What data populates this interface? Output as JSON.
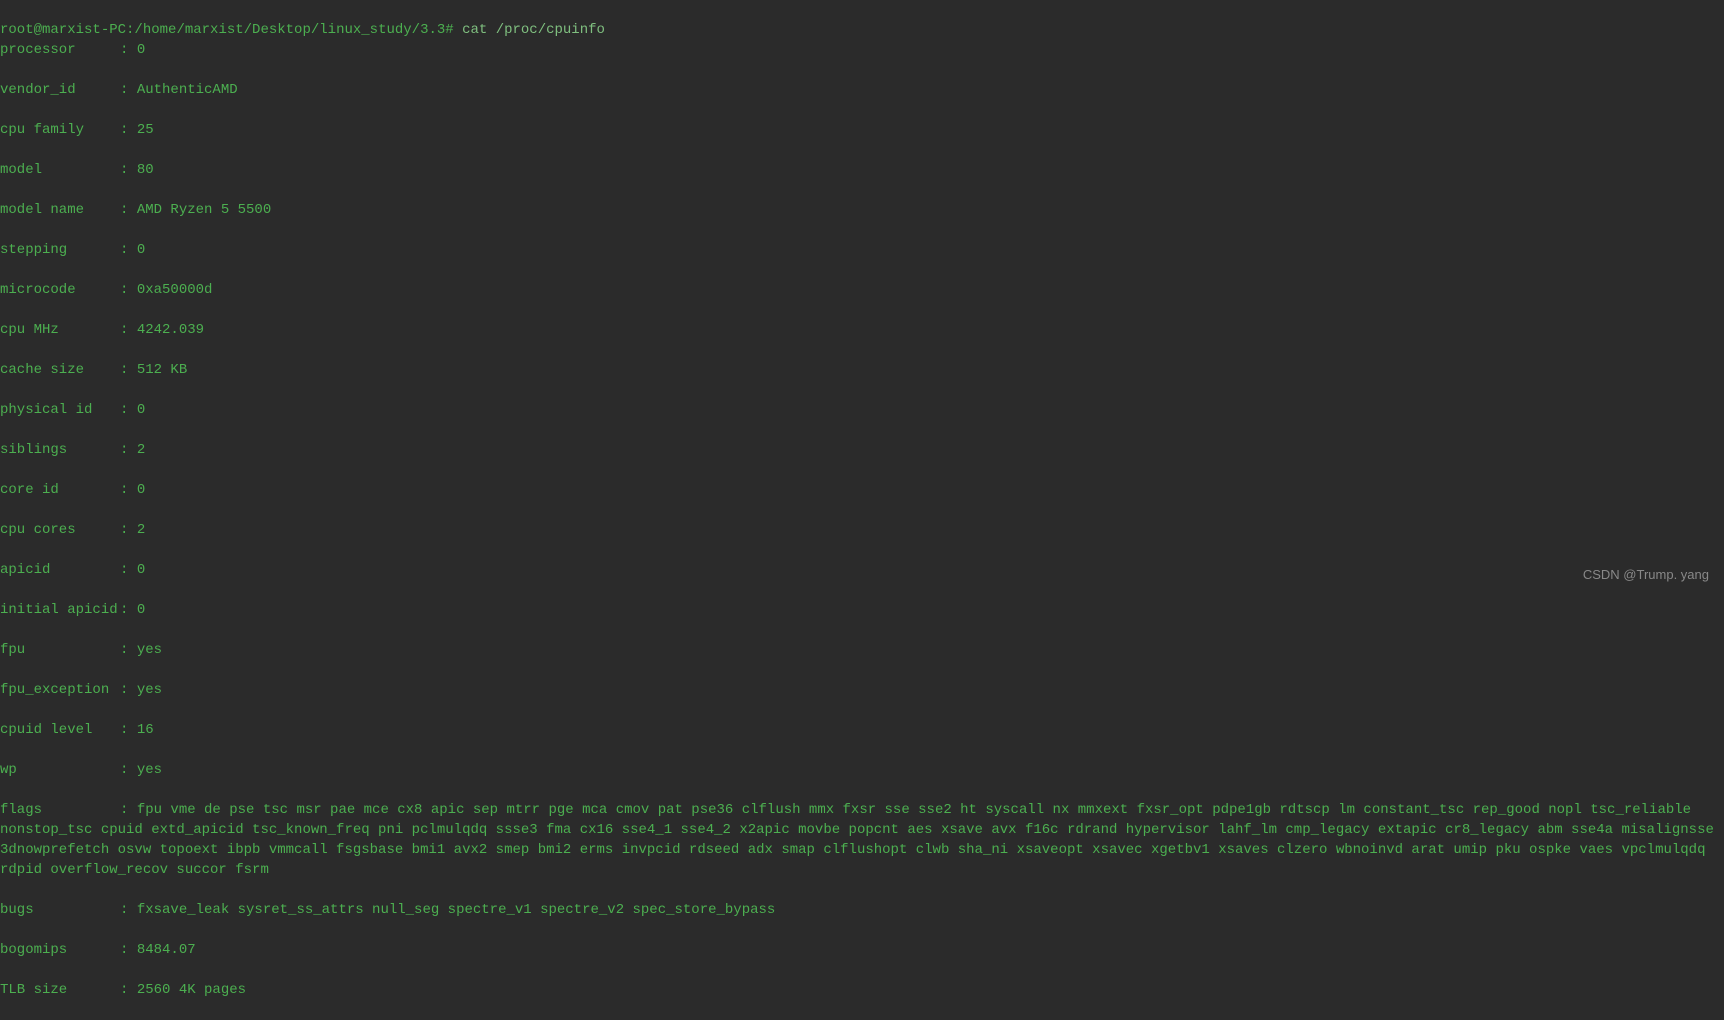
{
  "prompt": {
    "user_host": "root@marxist-PC",
    "path": ":/home/marxist/Desktop/linux_study/3.3#",
    "command": "cat /proc/cpuinfo"
  },
  "cpuinfo": {
    "processor": {
      "key": "processor",
      "val": "0"
    },
    "vendor_id": {
      "key": "vendor_id",
      "val": "AuthenticAMD"
    },
    "cpu_family": {
      "key": "cpu family",
      "val": "25"
    },
    "model": {
      "key": "model",
      "val": "80"
    },
    "model_name": {
      "key": "model name",
      "val": "AMD Ryzen 5 5500"
    },
    "stepping": {
      "key": "stepping",
      "val": "0"
    },
    "microcode": {
      "key": "microcode",
      "val": "0xa50000d"
    },
    "cpu_mhz": {
      "key": "cpu MHz",
      "val": "4242.039"
    },
    "cache_size": {
      "key": "cache size",
      "val": "512 KB"
    },
    "physical_id": {
      "key": "physical id",
      "val": "0"
    },
    "siblings": {
      "key": "siblings",
      "val": "2"
    },
    "core_id": {
      "key": "core id",
      "val": "0"
    },
    "cpu_cores": {
      "key": "cpu cores",
      "val": "2"
    },
    "apicid": {
      "key": "apicid",
      "val": "0"
    },
    "initial_apicid": {
      "key": "initial apicid",
      "val": "0"
    },
    "fpu": {
      "key": "fpu",
      "val": "yes"
    },
    "fpu_exception": {
      "key": "fpu_exception",
      "val": "yes"
    },
    "cpuid_level": {
      "key": "cpuid level",
      "val": "16"
    },
    "wp": {
      "key": "wp",
      "val": "yes"
    },
    "flags": {
      "key": "flags",
      "val": "fpu vme de pse tsc msr pae mce cx8 apic sep mtrr pge mca cmov pat pse36 clflush mmx fxsr sse sse2 ht syscall nx mmxext fxsr_opt pdpe1gb rdtscp lm constant_tsc rep_good nopl tsc_reliable nonstop_tsc cpuid extd_apicid tsc_known_freq pni pclmulqdq ssse3 fma cx16 sse4_1 sse4_2 x2apic movbe popcnt aes xsave avx f16c rdrand hypervisor lahf_lm cmp_legacy extapic cr8_legacy abm sse4a misalignsse 3dnowprefetch osvw topoext ibpb vmmcall fsgsbase bmi1 avx2 smep bmi2 erms invpcid rdseed adx smap clflushopt clwb sha_ni xsaveopt xsavec xgetbv1 xsaves clzero wbnoinvd arat umip pku ospke vaes vpclmulqdq rdpid overflow_recov succor fsrm"
    },
    "bugs": {
      "key": "bugs",
      "val": "fxsave_leak sysret_ss_attrs null_seg spectre_v1 spectre_v2 spec_store_bypass"
    },
    "bogomips": {
      "key": "bogomips",
      "val": "8484.07"
    },
    "tlb_size": {
      "key": "TLB size",
      "val": "2560 4K pages"
    }
  },
  "watermark": "CSDN @Trump. yang"
}
